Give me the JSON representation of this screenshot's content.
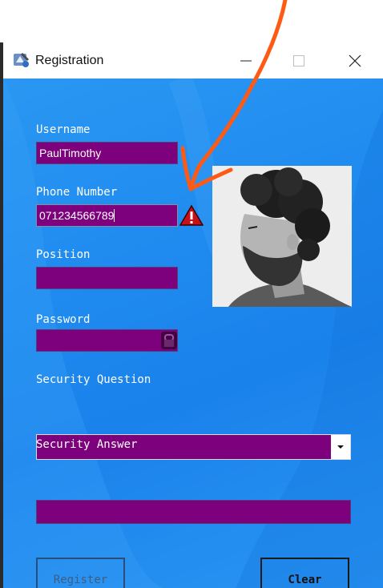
{
  "window": {
    "title": "Registration",
    "controls": {
      "minimize": "minimize",
      "maximize": "maximize",
      "close": "close"
    }
  },
  "form": {
    "username": {
      "label": "Username",
      "value": "PaulTimothy"
    },
    "phone": {
      "label": "Phone Number",
      "value": "071234566789",
      "error_icon": "warning-icon"
    },
    "position": {
      "label": "Position",
      "value": ""
    },
    "password": {
      "label": "Password",
      "value": "",
      "icon": "lock-icon"
    },
    "security_question": {
      "label": "Security Question",
      "value": ""
    },
    "security_answer": {
      "label": "Security Answer",
      "value": ""
    }
  },
  "photo": {
    "icon": "profile-photo"
  },
  "buttons": {
    "register": {
      "label": "Register",
      "enabled": false
    },
    "clear": {
      "label": "Clear",
      "enabled": true
    }
  },
  "colors": {
    "field_bg": "#7d007d",
    "client_bg": "#1f8bf0",
    "annotation_arrow": "#ff5a14"
  }
}
